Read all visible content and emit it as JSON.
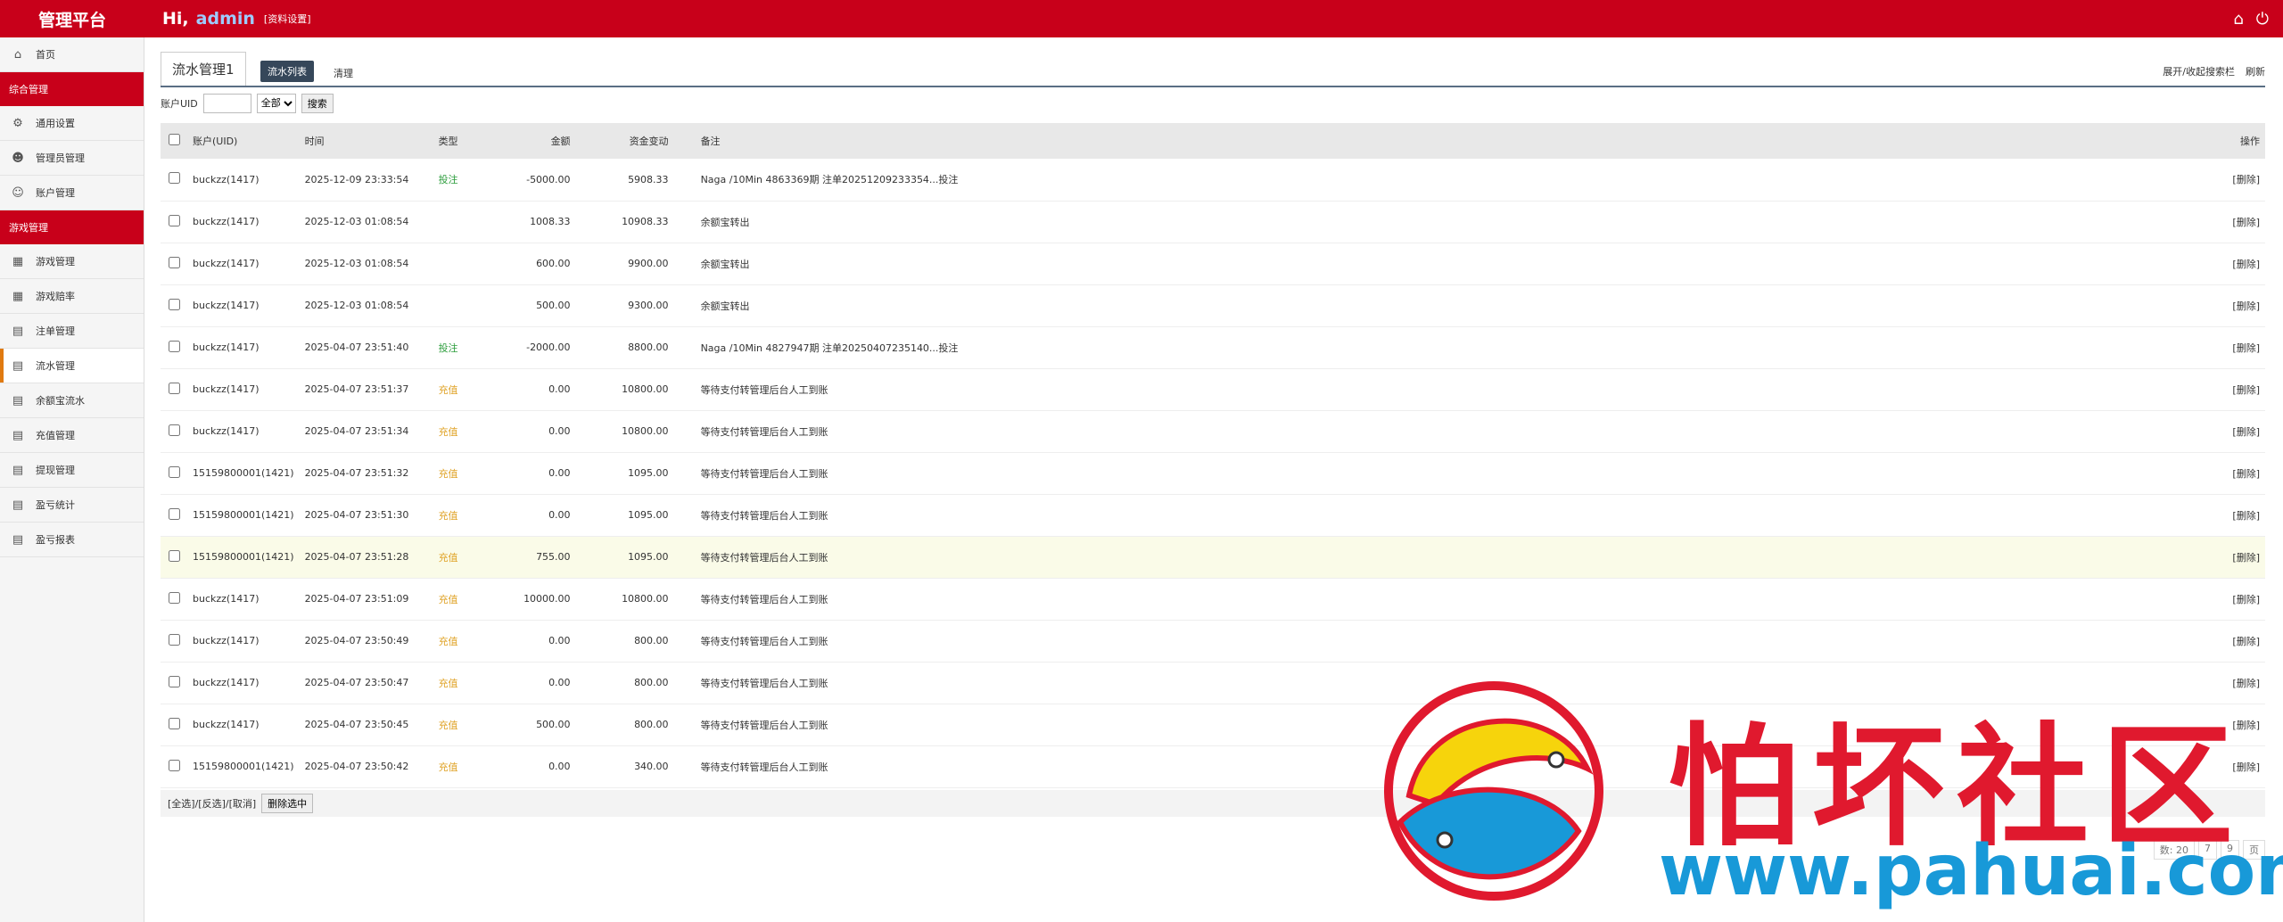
{
  "header": {
    "brand": "管理平台",
    "greeting": "Hi,",
    "username": "admin",
    "profile_link": "[资料设置]"
  },
  "sidebar": {
    "items": [
      {
        "label": "首页",
        "icon": "home-icon",
        "type": "item"
      },
      {
        "label": "综合管理",
        "type": "section"
      },
      {
        "label": "通用设置",
        "icon": "gear-icon",
        "type": "item"
      },
      {
        "label": "管理员管理",
        "icon": "users-icon",
        "type": "item"
      },
      {
        "label": "账户管理",
        "icon": "user-icon",
        "type": "item"
      },
      {
        "label": "游戏管理",
        "type": "section"
      },
      {
        "label": "游戏管理",
        "icon": "grid-icon",
        "type": "item"
      },
      {
        "label": "游戏赔率",
        "icon": "grid-icon",
        "type": "item"
      },
      {
        "label": "注单管理",
        "icon": "list-icon",
        "type": "item"
      },
      {
        "label": "流水管理",
        "icon": "list-icon",
        "type": "item",
        "active": true
      },
      {
        "label": "余额宝流水",
        "icon": "list-icon",
        "type": "item"
      },
      {
        "label": "充值管理",
        "icon": "list-icon",
        "type": "item"
      },
      {
        "label": "提现管理",
        "icon": "list-icon",
        "type": "item"
      },
      {
        "label": "盈亏统计",
        "icon": "list-icon",
        "type": "item"
      },
      {
        "label": "盈亏报表",
        "icon": "list-icon",
        "type": "item"
      }
    ]
  },
  "tabs": {
    "title": "流水管理1",
    "list_btn": "流水列表",
    "clear_link": "清理",
    "toggle_search": "展开/收起搜索栏",
    "refresh": "刷新"
  },
  "search": {
    "uid_label": "账户UID",
    "select_value": "全部",
    "search_btn": "搜索"
  },
  "table": {
    "headers": {
      "uid": "账户(UID)",
      "time": "时间",
      "type": "类型",
      "amount": "金额",
      "balance": "资金变动",
      "note": "备注",
      "action": "操作"
    },
    "rows": [
      {
        "uid": "buckzz(1417)",
        "time": "2025-12-09 23:33:54",
        "type": "投注",
        "amount": "-5000.00",
        "balance": "5908.33",
        "note": "Naga /10Min 4863369期 注单20251209233354...投注",
        "action": "[删除]"
      },
      {
        "uid": "buckzz(1417)",
        "time": "2025-12-03 01:08:54",
        "type": "",
        "amount": "1008.33",
        "balance": "10908.33",
        "note": "余额宝转出",
        "action": "[删除]"
      },
      {
        "uid": "buckzz(1417)",
        "time": "2025-12-03 01:08:54",
        "type": "",
        "amount": "600.00",
        "balance": "9900.00",
        "note": "余额宝转出",
        "action": "[删除]"
      },
      {
        "uid": "buckzz(1417)",
        "time": "2025-12-03 01:08:54",
        "type": "",
        "amount": "500.00",
        "balance": "9300.00",
        "note": "余额宝转出",
        "action": "[删除]"
      },
      {
        "uid": "buckzz(1417)",
        "time": "2025-04-07 23:51:40",
        "type": "投注",
        "amount": "-2000.00",
        "balance": "8800.00",
        "note": "Naga /10Min 4827947期 注单20250407235140...投注",
        "action": "[删除]"
      },
      {
        "uid": "buckzz(1417)",
        "time": "2025-04-07 23:51:37",
        "type": "充值",
        "amount": "0.00",
        "balance": "10800.00",
        "note": "等待支付转管理后台人工到账",
        "action": "[删除]"
      },
      {
        "uid": "buckzz(1417)",
        "time": "2025-04-07 23:51:34",
        "type": "充值",
        "amount": "0.00",
        "balance": "10800.00",
        "note": "等待支付转管理后台人工到账",
        "action": "[删除]"
      },
      {
        "uid": "15159800001(1421)",
        "time": "2025-04-07 23:51:32",
        "type": "充值",
        "amount": "0.00",
        "balance": "1095.00",
        "note": "等待支付转管理后台人工到账",
        "action": "[删除]"
      },
      {
        "uid": "15159800001(1421)",
        "time": "2025-04-07 23:51:30",
        "type": "充值",
        "amount": "0.00",
        "balance": "1095.00",
        "note": "等待支付转管理后台人工到账",
        "action": "[删除]"
      },
      {
        "uid": "15159800001(1421)",
        "time": "2025-04-07 23:51:28",
        "type": "充值",
        "amount": "755.00",
        "balance": "1095.00",
        "note": "等待支付转管理后台人工到账",
        "action": "[删除]",
        "highlight": true
      },
      {
        "uid": "buckzz(1417)",
        "time": "2025-04-07 23:51:09",
        "type": "充值",
        "amount": "10000.00",
        "balance": "10800.00",
        "note": "等待支付转管理后台人工到账",
        "action": "[删除]"
      },
      {
        "uid": "buckzz(1417)",
        "time": "2025-04-07 23:50:49",
        "type": "充值",
        "amount": "0.00",
        "balance": "800.00",
        "note": "等待支付转管理后台人工到账",
        "action": "[删除]"
      },
      {
        "uid": "buckzz(1417)",
        "time": "2025-04-07 23:50:47",
        "type": "充值",
        "amount": "0.00",
        "balance": "800.00",
        "note": "等待支付转管理后台人工到账",
        "action": "[删除]"
      },
      {
        "uid": "buckzz(1417)",
        "time": "2025-04-07 23:50:45",
        "type": "充值",
        "amount": "500.00",
        "balance": "800.00",
        "note": "等待支付转管理后台人工到账",
        "action": "[删除]"
      },
      {
        "uid": "15159800001(1421)",
        "time": "2025-04-07 23:50:42",
        "type": "充值",
        "amount": "0.00",
        "balance": "340.00",
        "note": "等待支付转管理后台人工到账",
        "action": "[删除]"
      }
    ]
  },
  "footer": {
    "select_links": "[全选]/[反选]/[取消]",
    "delete_selected": "删除选中"
  },
  "pager": {
    "items": [
      "数: 20",
      "7",
      "9",
      "页"
    ]
  },
  "watermark": {
    "text": "怕坏社区",
    "url": "www.pahuai.com"
  },
  "colors": {
    "brand_red": "#c8001a",
    "bet_green": "#2e9e3e",
    "deposit_gold": "#e0a42a",
    "active_marker": "#e07a10"
  }
}
